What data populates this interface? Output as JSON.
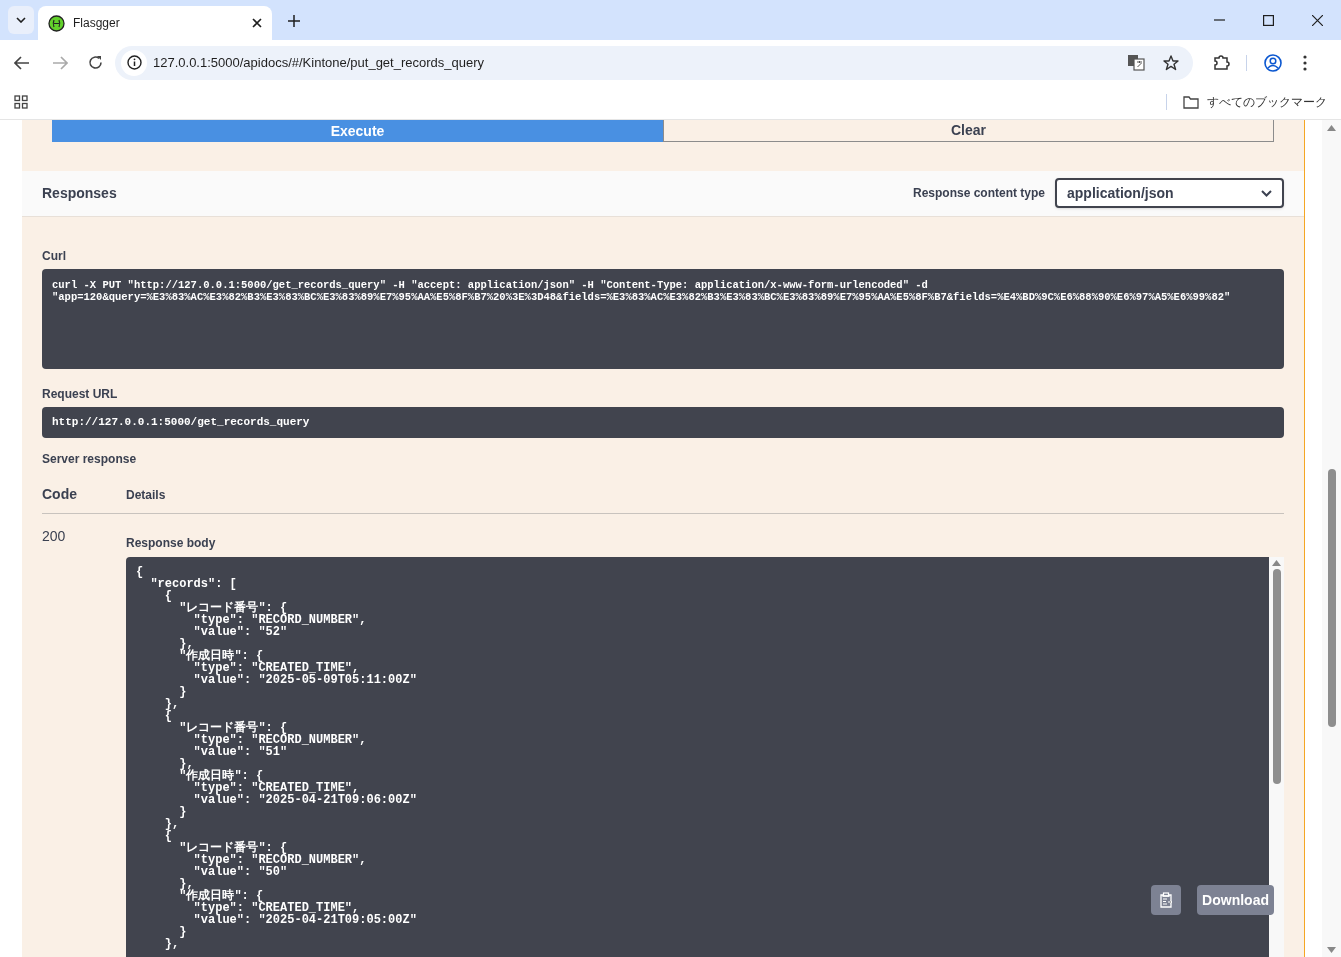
{
  "browser": {
    "tab_title": "Flasgger",
    "address": "127.0.0.1:5000/apidocs/#/Kintone/put_get_records_query",
    "bookmarks_label": "すべてのブックマーク"
  },
  "actions": [
    {
      "label": "Execute",
      "kind": "primary"
    },
    {
      "label": "Clear",
      "kind": "secondary"
    }
  ],
  "responses": {
    "title": "Responses",
    "content_type_label": "Response content type",
    "content_type": "application/json"
  },
  "curl": {
    "label": "Curl",
    "command": "curl -X PUT \"http://127.0.0.1:5000/get_records_query\" -H \"accept: application/json\" -H \"Content-Type: application/x-www-form-urlencoded\" -d\n\"app=120&query=%E3%83%AC%E3%82%B3%E3%83%BC%E3%83%89%E7%95%AA%E5%8F%B7%20%3E%3D48&fields=%E3%83%AC%E3%82%B3%E3%83%BC%E3%83%89%E7%95%AA%E5%8F%B7&fields=%E4%BD%9C%E6%88%90%E6%97%A5%E6%99%82\""
  },
  "request_url": {
    "label": "Request URL",
    "value": "http://127.0.0.1:5000/get_records_query"
  },
  "server_response": {
    "title": "Server response",
    "columns": [
      "Code",
      "Details"
    ],
    "code": "200",
    "body_label": "Response body",
    "body": "{\n  \"records\": [\n    {\n      \"レコード番号\": {\n        \"type\": \"RECORD_NUMBER\",\n        \"value\": \"52\"\n      },\n      \"作成日時\": {\n        \"type\": \"CREATED_TIME\",\n        \"value\": \"2025-05-09T05:11:00Z\"\n      }\n    },\n    {\n      \"レコード番号\": {\n        \"type\": \"RECORD_NUMBER\",\n        \"value\": \"51\"\n      },\n      \"作成日時\": {\n        \"type\": \"CREATED_TIME\",\n        \"value\": \"2025-04-21T09:06:00Z\"\n      }\n    },\n    {\n      \"レコード番号\": {\n        \"type\": \"RECORD_NUMBER\",\n        \"value\": \"50\"\n      },\n      \"作成日時\": {\n        \"type\": \"CREATED_TIME\",\n        \"value\": \"2025-04-21T09:05:00Z\"\n      }\n    },"
  },
  "body_buttons": [
    {
      "kind": "copy"
    },
    {
      "kind": "download",
      "label": "Download"
    }
  ]
}
